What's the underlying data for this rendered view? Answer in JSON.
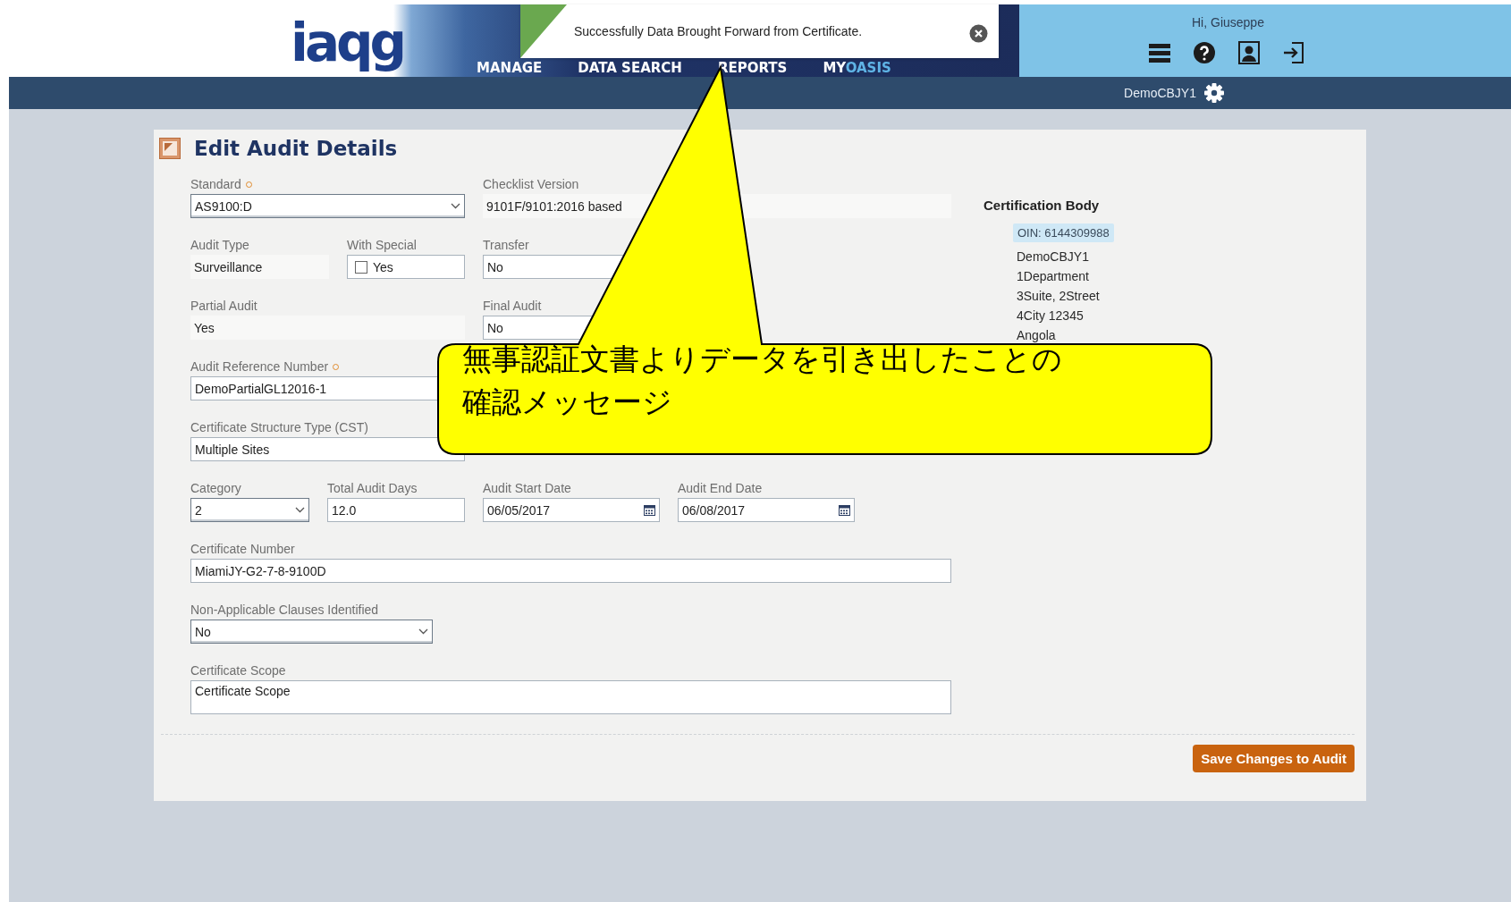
{
  "header": {
    "logo": "iaqg",
    "nav": [
      {
        "label": "MANAGE"
      },
      {
        "label": "DATA SEARCH"
      },
      {
        "label": "REPORTS"
      },
      {
        "label": "MY",
        "accent": "OASIS"
      }
    ],
    "greeting": "Hi, Giuseppe",
    "account": "DemoCBJY1"
  },
  "toast": {
    "message": "Successfully Data Brought Forward from Certificate."
  },
  "form": {
    "title": "Edit Audit Details",
    "rows": [
      {
        "fields": [
          {
            "label": "Standard",
            "required": true,
            "kind": "select",
            "value": "AS9100:D"
          },
          {
            "label": "Checklist Version",
            "kind": "static",
            "value": "9101F/9101:2016 based"
          }
        ]
      },
      {
        "fields": [
          {
            "label": "Audit Type",
            "kind": "static",
            "value": "Surveillance"
          },
          {
            "label": "With Special",
            "kind": "checkbox",
            "value": "Yes",
            "checked": false
          },
          {
            "label": "Transfer",
            "kind": "text",
            "value": "No"
          }
        ]
      },
      {
        "fields": [
          {
            "label": "Partial Audit",
            "kind": "static",
            "value": "Yes"
          },
          {
            "label": "Final Audit",
            "kind": "text",
            "value": "No"
          }
        ]
      },
      {
        "fields": [
          {
            "label": "Audit Reference Number",
            "required": true,
            "kind": "text",
            "value": "DemoPartialGL12016-1"
          }
        ]
      },
      {
        "fields": [
          {
            "label": "Certificate Structure Type (CST)",
            "kind": "text",
            "value": "Multiple Sites"
          }
        ]
      },
      {
        "fields": [
          {
            "label": "Category",
            "kind": "select",
            "value": "2"
          },
          {
            "label": "Total Audit Days",
            "kind": "text",
            "value": "12.0"
          },
          {
            "label": "Audit Start Date",
            "kind": "date",
            "value": "06/05/2017"
          },
          {
            "label": "Audit End Date",
            "kind": "date",
            "value": "06/08/2017"
          }
        ]
      },
      {
        "fields": [
          {
            "label": "Certificate Number",
            "kind": "text",
            "value": "MiamiJY-G2-7-8-9100D"
          }
        ]
      },
      {
        "fields": [
          {
            "label": "Non-Applicable Clauses Identified",
            "kind": "select",
            "value": "No"
          }
        ]
      },
      {
        "fields": [
          {
            "label": "Certificate Scope",
            "kind": "textarea",
            "value": "Certificate Scope"
          }
        ]
      }
    ]
  },
  "certification_body": {
    "title": "Certification Body",
    "oin": "OIN: 6144309988",
    "lines": [
      "DemoCBJY1",
      "1Department",
      "3Suite, 2Street",
      "4City 12345",
      "Angola"
    ]
  },
  "save_button": "Save Changes to Audit",
  "annotation": {
    "lines": [
      "無事認証文書よりデータを引き出したことの",
      "確認メッセージ"
    ]
  }
}
